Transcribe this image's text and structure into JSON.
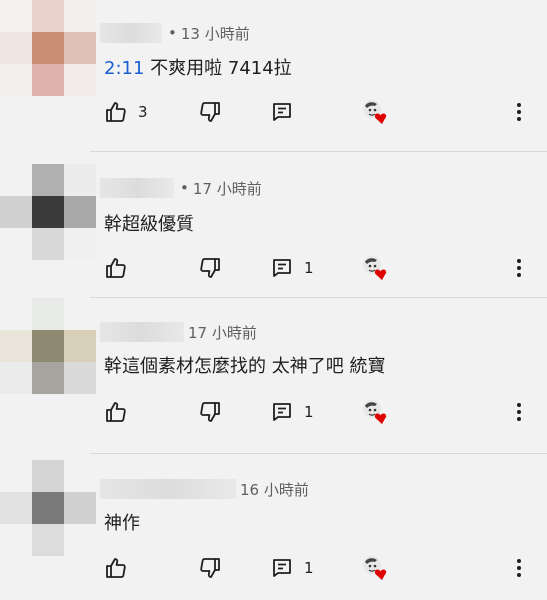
{
  "comments": [
    {
      "time": "13 小時前",
      "timestamp_link": "2:11",
      "text": " 不爽用啦 7414拉",
      "likes": "3",
      "replies": ""
    },
    {
      "time": "17 小時前",
      "timestamp_link": "",
      "text": "幹超級優質",
      "likes": "",
      "replies": "1"
    },
    {
      "time": "17 小時前",
      "timestamp_link": "",
      "text": "幹這個素材怎麼找的 太神了吧 統寶",
      "likes": "",
      "replies": "1"
    },
    {
      "time": "16 小時前",
      "timestamp_link": "",
      "text": "神作",
      "likes": "",
      "replies": "1"
    }
  ],
  "colors": {
    "accent_link": "#1a5fd0",
    "heart": "#e00000",
    "icon": "#1f1f1f",
    "meta_text": "#606060"
  },
  "icons": [
    "thumb-up-icon",
    "thumb-down-icon",
    "reply-icon",
    "creator-heart-icon",
    "more-vert-icon"
  ]
}
